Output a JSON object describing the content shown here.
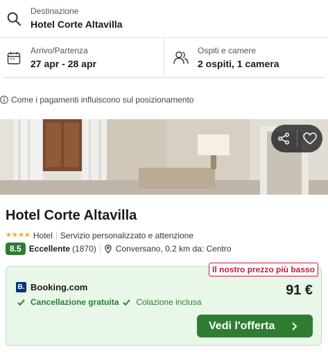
{
  "search": {
    "destination_label": "Destinazione",
    "destination_value": "Hotel Corte Altavilla",
    "dates_label": "Arrivo/Partenza",
    "dates_value": "27 apr - 28 apr",
    "guests_label": "Ospiti e camere",
    "guests_value": "2 ospiti, 1 camera"
  },
  "info_link": "Come i pagamenti influiscono sul posizionamento",
  "hotel": {
    "name": "Hotel Corte Altavilla",
    "stars": 4,
    "type": "Hotel",
    "tagline": "Servizio personalizzato e attenzione",
    "score": "8.5",
    "rating_label": "Eccellente",
    "review_count": "(1870)",
    "location": "Conversano, 0.2 km da: Centro"
  },
  "offer": {
    "badge": "Il nostro prezzo più basso",
    "provider_logo": "B.",
    "provider": "Booking.com",
    "price": "91 €",
    "feature_1": "Cancellazione gratuita",
    "feature_2": "Colazione inclusa",
    "cta": "Vedi l'offerta"
  },
  "icons": {
    "search": "search-icon",
    "calendar": "calendar-icon",
    "guests": "people-icon",
    "info": "info-icon",
    "share": "share-icon",
    "favorite": "heart-icon",
    "pin": "map-pin-icon",
    "check": "check-icon",
    "chevron": "chevron-right-icon"
  },
  "colors": {
    "accent_green": "#2e7d32",
    "offer_bg": "#e8f7e8",
    "badge_red": "#c41a3a",
    "star_yellow": "#f5a623",
    "booking_blue": "#003580"
  }
}
